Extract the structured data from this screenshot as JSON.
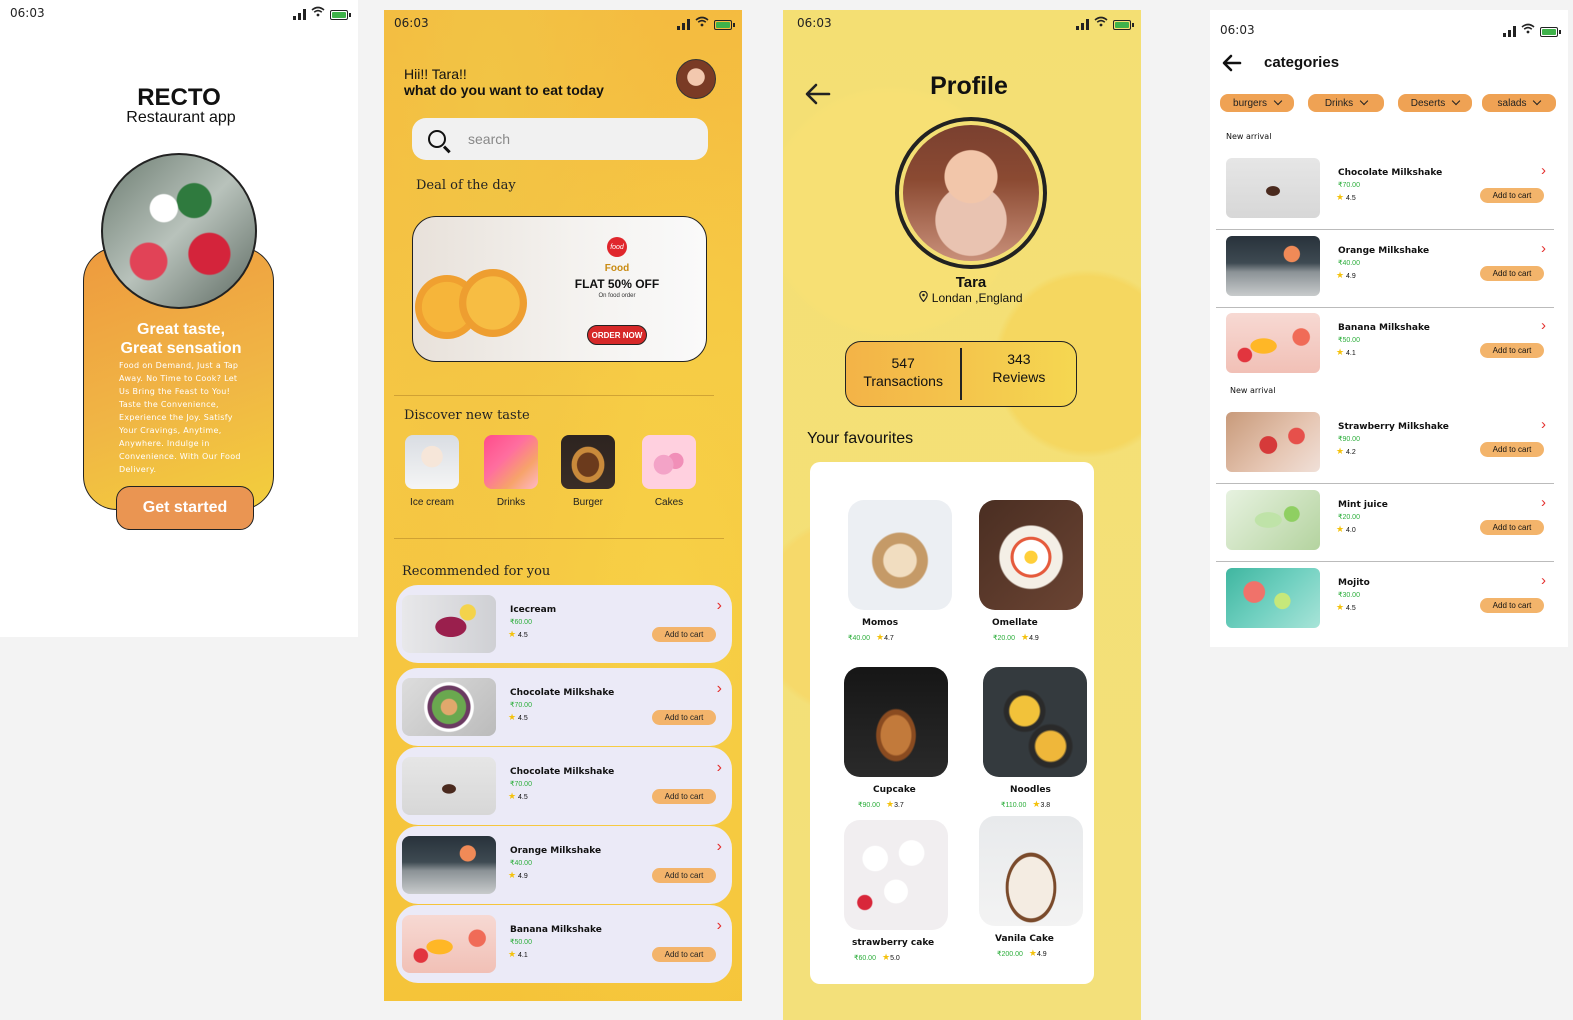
{
  "status": {
    "time": "06:03"
  },
  "welcome": {
    "brand": "RECTO",
    "subtitle": "Restaurant app",
    "headline_1": "Great taste,",
    "headline_2": "Great sensation",
    "description": "Food on Demand, Just a Tap Away. No Time to Cook? Let Us Bring the Feast to You! Taste the Convenience, Experience the Joy. Satisfy Your Cravings, Anytime, Anywhere. Indulge in Convenience. With Our Food Delivery.",
    "cta": "Get started"
  },
  "home": {
    "greeting": "Hii!!  Tara!!",
    "question": "what do you want to eat today",
    "search_placeholder": "search",
    "deal_heading": "Deal of the day",
    "deal": {
      "logo": "food",
      "brand": "Food",
      "offer": "FLAT 50% OFF",
      "note": "On food order",
      "button": "ORDER NOW"
    },
    "discover_heading": "Discover new taste",
    "categories": [
      {
        "label": "Ice cream",
        "icon": "ice-cream"
      },
      {
        "label": "Drinks",
        "icon": "drinks"
      },
      {
        "label": "Burger",
        "icon": "burger"
      },
      {
        "label": "Cakes",
        "icon": "cakes"
      }
    ],
    "recommended_heading": "Recommended for you",
    "recommended": [
      {
        "name": "Icecream",
        "price": "₹60.00",
        "rating": "4.5",
        "cta": "Add to cart"
      },
      {
        "name": "Chocolate Milkshake",
        "price": "₹70.00",
        "rating": "4.5",
        "cta": "Add to cart"
      },
      {
        "name": "Chocolate Milkshake",
        "price": "₹70.00",
        "rating": "4.5",
        "cta": "Add to cart"
      },
      {
        "name": "Orange Milkshake",
        "price": "₹40.00",
        "rating": "4.9",
        "cta": "Add to cart"
      },
      {
        "name": "Banana Milkshake",
        "price": "₹50.00",
        "rating": "4.1",
        "cta": "Add to cart"
      }
    ]
  },
  "profile": {
    "title": "Profile",
    "name": "Tara",
    "location": "Londan ,England",
    "transactions_count": "547",
    "transactions_label": "Transactions",
    "reviews_count": "343",
    "reviews_label": "Reviews",
    "favourites_heading": "Your favourites",
    "favourites": [
      {
        "name": "Momos",
        "price": "₹40.00",
        "rating": "4.7"
      },
      {
        "name": "Omellate",
        "price": "₹20.00",
        "rating": "4.9"
      },
      {
        "name": "Cupcake",
        "price": "₹90.00",
        "rating": "3.7"
      },
      {
        "name": "Noodles",
        "price": "₹110.00",
        "rating": "3.8"
      },
      {
        "name": "strawberry cake",
        "price": "₹60.00",
        "rating": "5.0"
      },
      {
        "name": "Vanila Cake",
        "price": "₹200.00",
        "rating": "4.9"
      }
    ]
  },
  "categories": {
    "title": "categories",
    "chips": [
      "burgers",
      "Drinks",
      "Deserts",
      "salads"
    ],
    "section_1": "New arrival",
    "section_2": "New arrival",
    "items": [
      {
        "name": "Chocolate Milkshake",
        "price": "₹70.00",
        "rating": "4.5",
        "cta": "Add to cart"
      },
      {
        "name": "Orange Milkshake",
        "price": "₹40.00",
        "rating": "4.9",
        "cta": "Add to cart"
      },
      {
        "name": "Banana Milkshake",
        "price": "₹50.00",
        "rating": "4.1",
        "cta": "Add to cart"
      },
      {
        "name": "Strawberry Milkshake",
        "price": "₹90.00",
        "rating": "4.2",
        "cta": "Add to cart"
      },
      {
        "name": "Mint juice",
        "price": "₹20.00",
        "rating": "4.0",
        "cta": "Add to cart"
      },
      {
        "name": "Mojito",
        "price": "₹30.00",
        "rating": "4.5",
        "cta": "Add to cart"
      }
    ]
  },
  "colors": {
    "accent": "#efa254",
    "price_green": "#2cae3b",
    "chevron_red": "#e4312f",
    "star": "#f4c20d"
  }
}
